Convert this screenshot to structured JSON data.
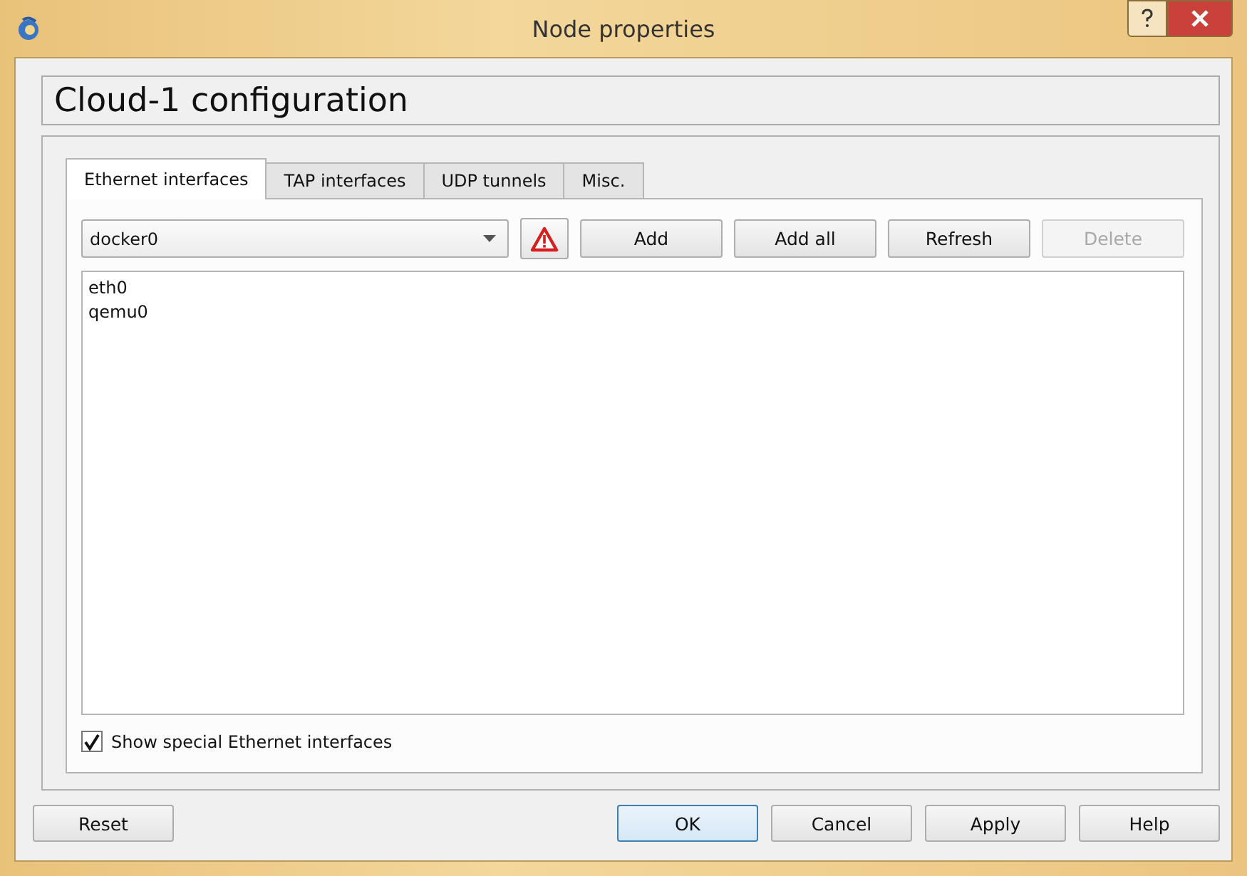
{
  "window": {
    "title": "Node properties"
  },
  "header": {
    "title": "Cloud-1 configuration"
  },
  "tabs": [
    {
      "label": "Ethernet interfaces",
      "selected": true
    },
    {
      "label": "TAP interfaces",
      "selected": false
    },
    {
      "label": "UDP tunnels",
      "selected": false
    },
    {
      "label": "Misc.",
      "selected": false
    }
  ],
  "interface_combo": {
    "value": "docker0"
  },
  "actions": [
    {
      "label": "Add",
      "disabled": false
    },
    {
      "label": "Add all",
      "disabled": false
    },
    {
      "label": "Refresh",
      "disabled": false
    },
    {
      "label": "Delete",
      "disabled": true
    }
  ],
  "interfaces": [
    "eth0",
    "qemu0"
  ],
  "show_special": {
    "label": "Show special Ethernet interfaces",
    "checked": true
  },
  "left_buttons": [
    {
      "label": "Reset",
      "default": false
    }
  ],
  "buttons": [
    {
      "label": "OK",
      "default": true
    },
    {
      "label": "Cancel",
      "default": false
    },
    {
      "label": "Apply",
      "default": false
    },
    {
      "label": "Help",
      "default": false
    }
  ]
}
